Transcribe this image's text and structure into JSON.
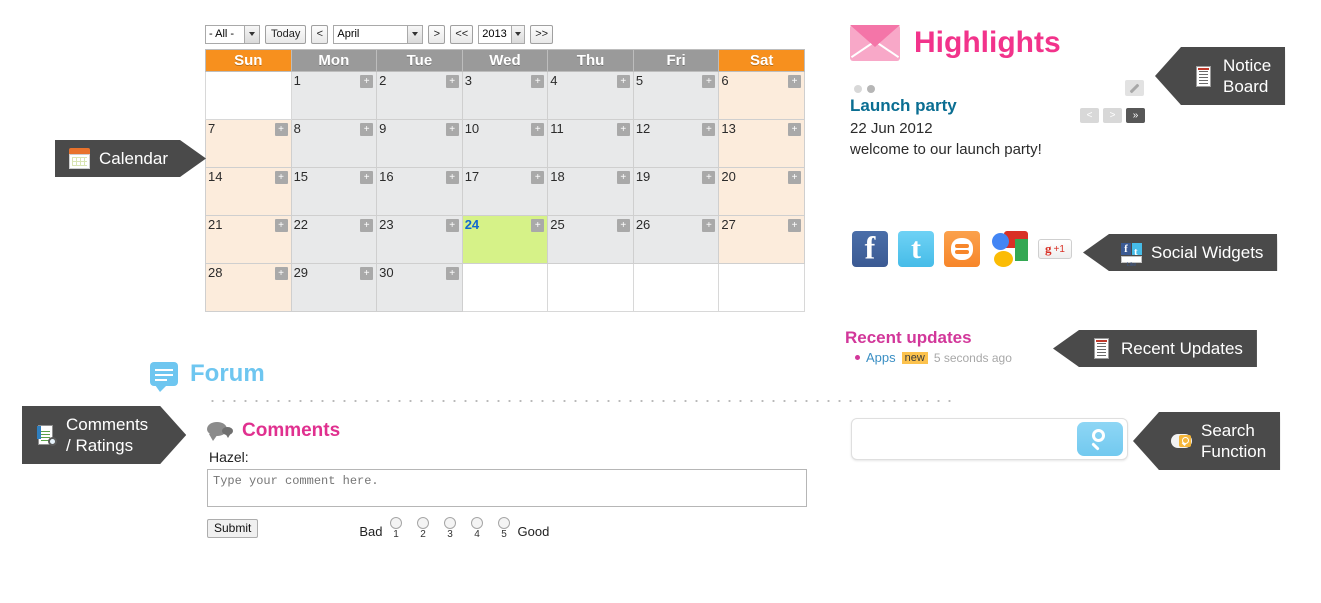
{
  "calendar": {
    "toolbar": {
      "scope_select": "- All -",
      "today_button": "Today",
      "prev_month_button": "<",
      "month_select": "April",
      "next_month_button": ">",
      "prev_year_button": "<<",
      "year_select": "2013",
      "next_year_button": ">>"
    },
    "weekday_headers": [
      "Sun",
      "Mon",
      "Tue",
      "Wed",
      "Thu",
      "Fri",
      "Sat"
    ],
    "add_event_label": "+",
    "today_date": 24,
    "weeks": [
      [
        null,
        1,
        2,
        3,
        4,
        5,
        6
      ],
      [
        7,
        8,
        9,
        10,
        11,
        12,
        13
      ],
      [
        14,
        15,
        16,
        17,
        18,
        19,
        20
      ],
      [
        21,
        22,
        23,
        24,
        25,
        26,
        27
      ],
      [
        28,
        29,
        30,
        null,
        null,
        null,
        null
      ]
    ]
  },
  "forum": {
    "title": "Forum",
    "comments": {
      "title": "Comments",
      "author": "Hazel:",
      "textarea_placeholder": "Type your comment here.",
      "textarea_value": "",
      "submit_label": "Submit",
      "rating": {
        "low_label": "Bad",
        "high_label": "Good",
        "options": [
          "1",
          "2",
          "3",
          "4",
          "5"
        ]
      }
    }
  },
  "highlights": {
    "title": "Highlights",
    "edit_button": "edit",
    "nav": {
      "prev": "<",
      "next": ">",
      "last": "»"
    },
    "item": {
      "title": "Launch party",
      "date": "22 Jun 2012",
      "description": "welcome to our launch party!"
    },
    "dots": 2
  },
  "social_widgets": [
    {
      "name": "facebook",
      "label": "f"
    },
    {
      "name": "twitter",
      "label": "t"
    },
    {
      "name": "blogger",
      "label": "b"
    },
    {
      "name": "google",
      "label": "G"
    },
    {
      "name": "google-plus-one",
      "label": "+1"
    }
  ],
  "recent_updates": {
    "title": "Recent updates",
    "items": [
      {
        "name": "Apps",
        "badge": "new",
        "time": "5 seconds ago"
      }
    ]
  },
  "search": {
    "placeholder": "",
    "value": "",
    "button_label": "search"
  },
  "callouts": {
    "calendar": "Calendar",
    "comments_ratings": "Comments\n/ Ratings",
    "notice_board": "Notice\nBoard",
    "social_widgets": "Social Widgets",
    "recent_updates": "Recent Updates",
    "search_function": "Search\nFunction"
  },
  "colors": {
    "weekend_header": "#f7901e",
    "weekday_header": "#9a9a9a",
    "today_cell": "#d6f288",
    "today_text": "#1268d0",
    "highlights_pink": "#f2338b",
    "forum_blue": "#6ec6f0",
    "comments_pink": "#e0308f",
    "recent_pink": "#d2379a",
    "callout_bg": "#4a4a4a",
    "search_blue": "#72c9ef"
  }
}
